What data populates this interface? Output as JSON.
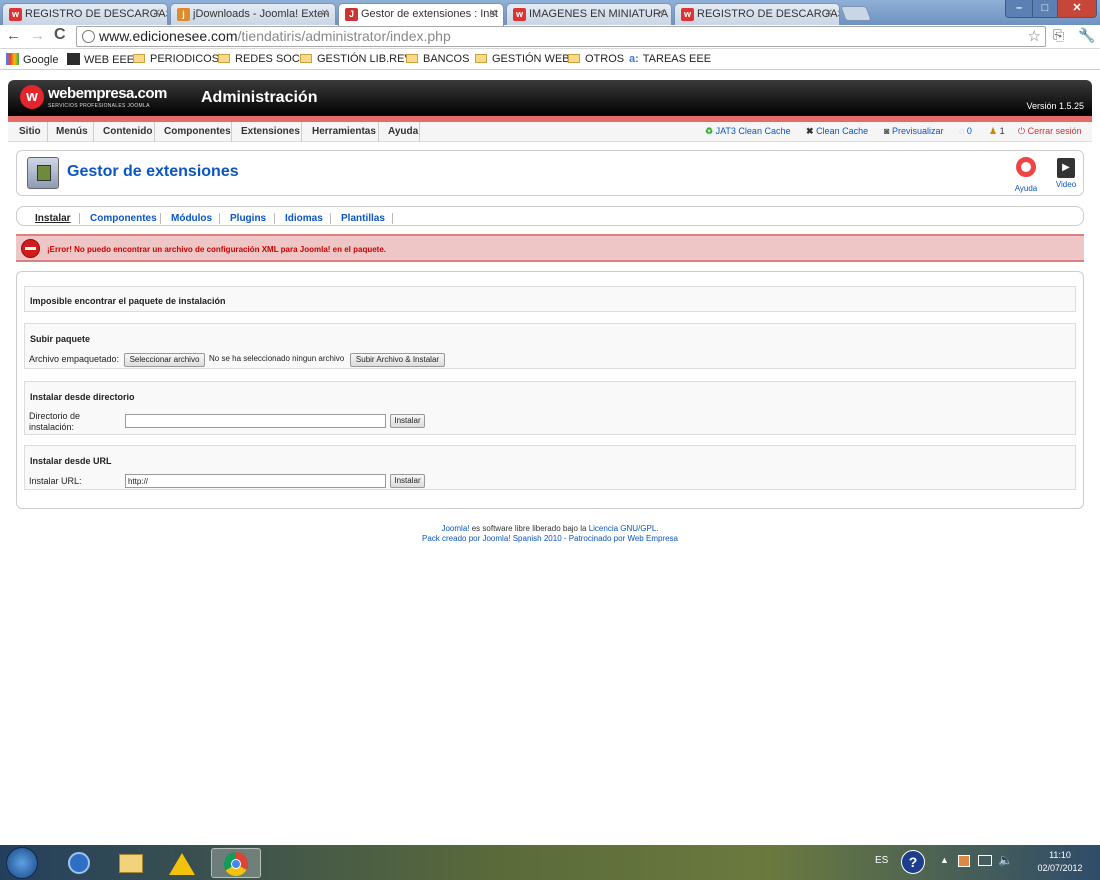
{
  "browser": {
    "tabs": [
      {
        "title": "REGISTRO DE DESCARGAS -",
        "active": false,
        "icon": "webempresa-favicon"
      },
      {
        "title": "jDownloads - Joomla! Exten",
        "active": false,
        "icon": "jdownloads-favicon"
      },
      {
        "title": "Gestor de extensiones : Inst",
        "active": true,
        "icon": "joomla-favicon"
      },
      {
        "title": "IMAGENES EN MINIATURA",
        "active": false,
        "icon": "webempresa-favicon"
      },
      {
        "title": "REGISTRO DE DESCARGAS -",
        "active": false,
        "icon": "webempresa-favicon"
      }
    ],
    "url_host": "www.edicionesee.com",
    "url_path": "/tiendatiris/administrator/index.php",
    "bookmarks": [
      "Google",
      "WEB EEE",
      "PERIODICOS",
      "REDES SOC.",
      "GESTIÓN LIB.REV",
      "BANCOS",
      "GESTIÓN WEB",
      "OTROS",
      "TAREAS EEE"
    ]
  },
  "joomla": {
    "logo": "webempresa.com",
    "logo_tagline": "SERVICIOS PROFESIONALES JOOMLA",
    "admin_title": "Administración",
    "version": "Versión 1.5.25",
    "menu": [
      "Sitio",
      "Menús",
      "Contenido",
      "Componentes",
      "Extensiones",
      "Herramientas",
      "Ayuda"
    ],
    "status": {
      "jat3": "JAT3 Clean Cache",
      "clean": "Clean Cache",
      "preview": "Previsualizar",
      "count1": "0",
      "count2": "1",
      "logout": "Cerrar sesión"
    },
    "page_title": "Gestor de extensiones",
    "toolbar": {
      "help": "Ayuda",
      "video": "Video"
    },
    "subnav": [
      "Instalar",
      "Componentes",
      "Módulos",
      "Plugins",
      "Idiomas",
      "Plantillas"
    ],
    "error": "¡Error! No puedo encontrar un archivo de configuración XML para Joomla! en el paquete.",
    "notice": "Imposible encontrar el paquete de instalación",
    "upload": {
      "legend": "Subir paquete",
      "label": "Archivo empaquetado:",
      "choose": "Seleccionar archivo",
      "nofile": "No se ha seleccionado ningun archivo",
      "submit": "Subir Archivo & Instalar"
    },
    "dir": {
      "legend": "Instalar desde directorio",
      "label1": "Directorio de",
      "label2": "instalación:",
      "value": "",
      "submit": "Instalar"
    },
    "url": {
      "legend": "Instalar desde URL",
      "label": "Instalar URL:",
      "value": "http://",
      "submit": "Instalar"
    },
    "footer": {
      "joomla": "Joomla!",
      "text1": " es software libre liberado bajo la ",
      "license": "Licencia GNU/GPL",
      "period": ".",
      "line2": "Pack creado por Joomla! Spanish 2010 - Patrocinado por Web Empresa"
    }
  },
  "taskbar": {
    "lang": "ES",
    "time": "11:10",
    "date": "02/07/2012"
  },
  "colors": {
    "error_bg": "#efc6c6",
    "link": "#0b55c4",
    "stripe": "#e56b6b"
  }
}
